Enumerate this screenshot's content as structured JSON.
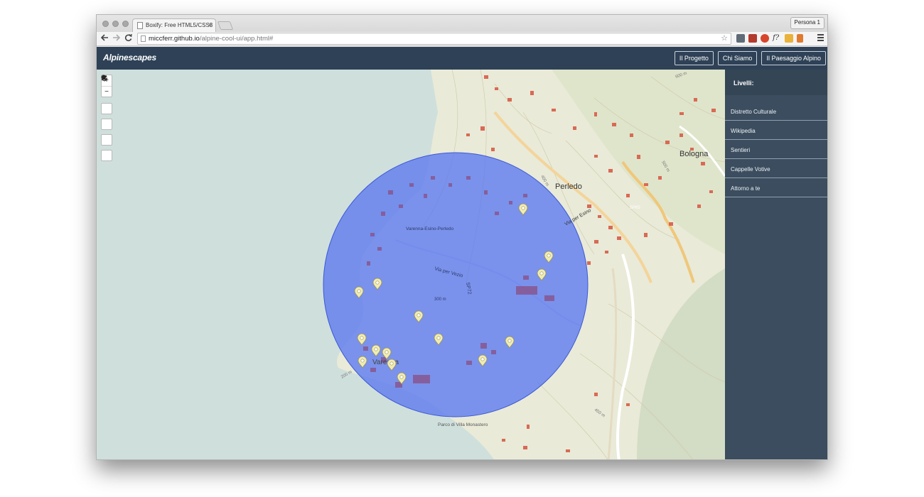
{
  "browser": {
    "tab_title": "Boxify: Free HTML5/CSS3",
    "tab_close": "×",
    "profile_label": "Persona 1",
    "url_host": "miccferr.github.io",
    "url_path": "/alpine-cool-ui/app.html#"
  },
  "app": {
    "brand": "Alpinescapes",
    "nav": [
      "Il Progetto",
      "Chi Siamo",
      "Il Paesaggio Alpino"
    ]
  },
  "map_controls": {
    "zoom_in": "+",
    "zoom_out": "−"
  },
  "map_labels": {
    "town_perledo": "Perledo",
    "town_bologna": "Bologna",
    "town_varenna": "Varenna",
    "road_via_per_vezio": "Via per Vezio",
    "road_sp72": "SP72",
    "road_via_per_esino": "Via per Esino",
    "road_sp65": "SP65",
    "station": "Varenna-Esino-Perledo",
    "park": "Parco di Villa Monastero",
    "elev_300": "300 m",
    "elev_400": "400 m",
    "elev_450": "450 m",
    "elev_500": "500 m",
    "elev_600": "600 m",
    "elev_200": "200 m"
  },
  "sidebar": {
    "title": "Livelli:",
    "layers": [
      "Distretto Culturale",
      "Wikipedia",
      "Sentieri",
      "Cappelle Votive",
      "Attorno a te"
    ]
  },
  "colors": {
    "navbar": "#2e4156",
    "sidebar": "#3b4d5e",
    "lake": "#cfdfdc",
    "land": "#e9ead8",
    "radius_fill": "#5b78f0",
    "building": "#d86a55",
    "marker": "#f1ecb0"
  }
}
